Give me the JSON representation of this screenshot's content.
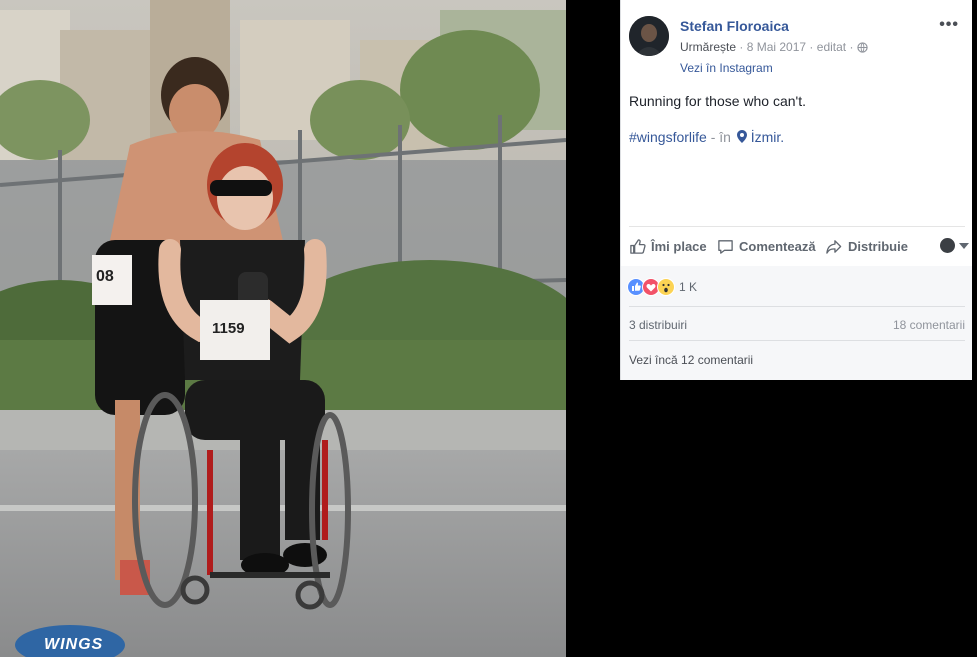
{
  "post": {
    "author": "Stefan Floroaica",
    "follow": "Urmărește",
    "date": "8 Mai 2017",
    "edited": "editat",
    "instagram": "Vezi în Instagram",
    "text": "Running for those who can't.",
    "hashtag": "#wingsforlife",
    "in_label": "în",
    "location": "İzmir."
  },
  "actions": {
    "like": "Îmi place",
    "comment": "Comentează",
    "share": "Distribuie"
  },
  "stats": {
    "reaction_count": "1 K",
    "shares": "3 distribuiri",
    "comments": "18 comentarii",
    "more_comments": "Vezi încă 12 comentarii"
  },
  "photo": {
    "bib_runner": "08",
    "bib_rider": "1159",
    "logo_text": "WINGS"
  },
  "colors": {
    "link": "#365899",
    "like_blue": "#5890ff",
    "love_red": "#f25268",
    "wow_yellow": "#fcd354"
  }
}
